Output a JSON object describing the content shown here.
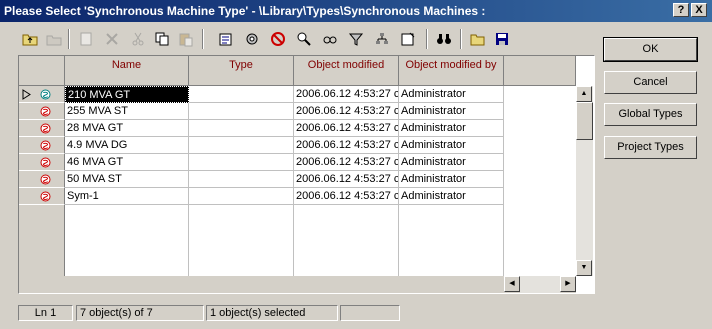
{
  "window": {
    "title": "Please Select 'Synchronous Machine Type' - \\Library\\Types\\Synchronous Machines :",
    "help_label": "?",
    "close_label": "X"
  },
  "table": {
    "columns": [
      "Name",
      "Type",
      "Object modified",
      "Object modified by"
    ],
    "rows": [
      {
        "name": "210 MVA GT",
        "type": "",
        "modified": "2006.06.12 4:53:27 c",
        "by": "Administrator"
      },
      {
        "name": "255 MVA ST",
        "type": "",
        "modified": "2006.06.12 4:53:27 c",
        "by": "Administrator"
      },
      {
        "name": "28 MVA GT",
        "type": "",
        "modified": "2006.06.12 4:53:27 c",
        "by": "Administrator"
      },
      {
        "name": "4.9 MVA DG",
        "type": "",
        "modified": "2006.06.12 4:53:27 c",
        "by": "Administrator"
      },
      {
        "name": "46 MVA GT",
        "type": "",
        "modified": "2006.06.12 4:53:27 c",
        "by": "Administrator"
      },
      {
        "name": "50 MVA ST",
        "type": "",
        "modified": "2006.06.12 4:53:27 c",
        "by": "Administrator"
      },
      {
        "name": "Sym-1",
        "type": "",
        "modified": "2006.06.12 4:53:27 c",
        "by": "Administrator"
      }
    ],
    "selected_row": 0
  },
  "buttons": {
    "ok": "OK",
    "cancel": "Cancel",
    "global_types": "Global Types",
    "project_types": "Project Types"
  },
  "status": {
    "line": "Ln 1",
    "count": "7 object(s) of 7",
    "selected": "1 object(s) selected"
  },
  "toolbar_icons": [
    "up-folder-icon",
    "new-folder-icon",
    "new-object-icon",
    "delete-icon",
    "cut-icon",
    "copy-icon",
    "paste-icon",
    "edit-icon",
    "settings-icon",
    "no-entry-icon",
    "find-object-icon",
    "search-icon",
    "filter-icon",
    "tree-icon",
    "note-icon",
    "binoculars-icon",
    "open-folder-icon",
    "save-icon"
  ],
  "colors": {
    "title_start": "#0a246a",
    "title_end": "#3a6ea5",
    "header_text": "#800000",
    "symbol_red": "#cc0000"
  }
}
